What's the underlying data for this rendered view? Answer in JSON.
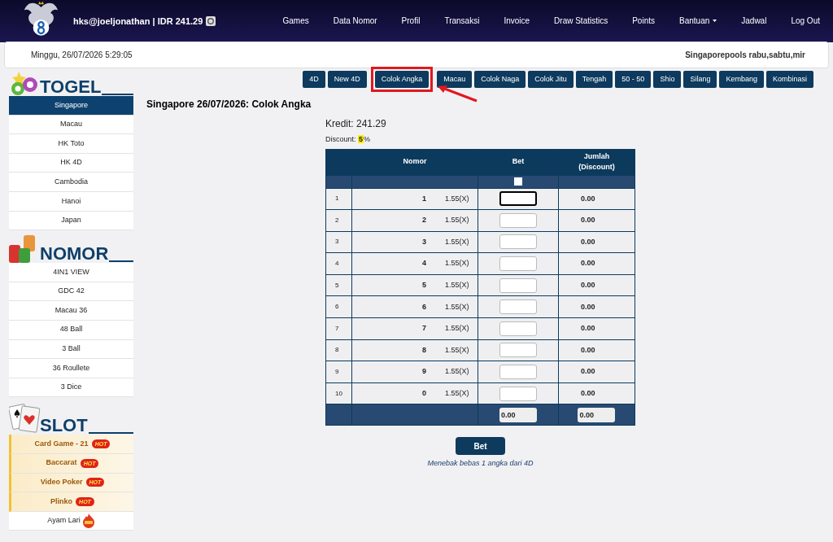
{
  "header": {
    "account": "hks@joeljonathan | IDR 241.29",
    "nav": [
      {
        "label": "Games",
        "dropdown": false
      },
      {
        "label": "Data Nomor",
        "dropdown": false
      },
      {
        "label": "Profil",
        "dropdown": false
      },
      {
        "label": "Transaksi",
        "dropdown": false
      },
      {
        "label": "Invoice",
        "dropdown": false
      },
      {
        "label": "Draw Statistics",
        "dropdown": false
      },
      {
        "label": "Points",
        "dropdown": false
      },
      {
        "label": "Bantuan",
        "dropdown": true
      },
      {
        "label": "Jadwal",
        "dropdown": false
      },
      {
        "label": "Log Out",
        "dropdown": false
      }
    ]
  },
  "info_bar": {
    "datetime": "Minggu, 26/07/2026 5:29:05",
    "schedule": "Singaporepools rabu,sabtu,mir"
  },
  "sidebar": [
    {
      "title": "TOGEL",
      "items": [
        {
          "label": "Singapore",
          "selected": true
        },
        {
          "label": "Macau",
          "selected": false
        },
        {
          "label": "HK Toto",
          "selected": false
        },
        {
          "label": "HK 4D",
          "selected": false
        },
        {
          "label": "Cambodia",
          "selected": false
        },
        {
          "label": "Hanoi",
          "selected": false
        },
        {
          "label": "Japan",
          "selected": false
        }
      ]
    },
    {
      "title": "NOMOR",
      "items": [
        {
          "label": "4IN1 VIEW",
          "selected": false
        },
        {
          "label": "GDC 42",
          "selected": false
        },
        {
          "label": "Macau 36",
          "selected": false
        },
        {
          "label": "48 Ball",
          "selected": false
        },
        {
          "label": "3 Ball",
          "selected": false
        },
        {
          "label": "36 Roullete",
          "selected": false
        },
        {
          "label": "3 Dice",
          "selected": false
        }
      ]
    },
    {
      "title": "SLOT",
      "items": [
        {
          "label": "Card Game - 21",
          "kind": "hot",
          "badge": "HOT",
          "selected": false
        },
        {
          "label": "Baccarat",
          "kind": "hot",
          "badge": "HOT",
          "selected": false
        },
        {
          "label": "Video Poker",
          "kind": "hot",
          "badge": "HOT",
          "selected": false
        },
        {
          "label": "Plinko",
          "kind": "hot",
          "badge": "HOT",
          "selected": false
        },
        {
          "label": "Ayam Lari",
          "kind": "fire",
          "selected": false
        }
      ]
    }
  ],
  "game_tabs": [
    {
      "label": "4D",
      "highlighted": false
    },
    {
      "label": "New 4D",
      "highlighted": false
    },
    {
      "label": "Colok Angka",
      "highlighted": true
    },
    {
      "label": "Macau",
      "highlighted": false
    },
    {
      "label": "Colok Naga",
      "highlighted": false
    },
    {
      "label": "Colok Jitu",
      "highlighted": false
    },
    {
      "label": "Tengah",
      "highlighted": false
    },
    {
      "label": "50 - 50",
      "highlighted": false
    },
    {
      "label": "Shio",
      "highlighted": false
    },
    {
      "label": "Silang",
      "highlighted": false
    },
    {
      "label": "Kembang",
      "highlighted": false
    },
    {
      "label": "Kombinasi",
      "highlighted": false
    }
  ],
  "page_title": "Singapore 26/07/2026: Colok Angka",
  "credit": {
    "label": "Kredit:",
    "value": "241.29"
  },
  "discount": {
    "label": "Discount:",
    "value": "5",
    "unit": "%"
  },
  "table": {
    "columns": [
      "Nomor",
      "Bet",
      "Jumlah (Discount)"
    ],
    "select_all_checked": false,
    "rows": [
      {
        "index": "1",
        "number": "1",
        "odds": "1.55(X)",
        "focused": true,
        "amount": "0.00"
      },
      {
        "index": "2",
        "number": "2",
        "odds": "1.55(X)",
        "focused": false,
        "amount": "0.00"
      },
      {
        "index": "3",
        "number": "3",
        "odds": "1.55(X)",
        "focused": false,
        "amount": "0.00"
      },
      {
        "index": "4",
        "number": "4",
        "odds": "1.55(X)",
        "focused": false,
        "amount": "0.00"
      },
      {
        "index": "5",
        "number": "5",
        "odds": "1.55(X)",
        "focused": false,
        "amount": "0.00"
      },
      {
        "index": "6",
        "number": "6",
        "odds": "1.55(X)",
        "focused": false,
        "amount": "0.00"
      },
      {
        "index": "7",
        "number": "7",
        "odds": "1.55(X)",
        "focused": false,
        "amount": "0.00"
      },
      {
        "index": "8",
        "number": "8",
        "odds": "1.55(X)",
        "focused": false,
        "amount": "0.00"
      },
      {
        "index": "9",
        "number": "9",
        "odds": "1.55(X)",
        "focused": false,
        "amount": "0.00"
      },
      {
        "index": "10",
        "number": "0",
        "odds": "1.55(X)",
        "focused": false,
        "amount": "0.00"
      }
    ],
    "totals": {
      "bet": "0.00",
      "amount": "0.00"
    }
  },
  "submit": "Bet",
  "hint": "Menebak bebas 1 angka dari 4D"
}
